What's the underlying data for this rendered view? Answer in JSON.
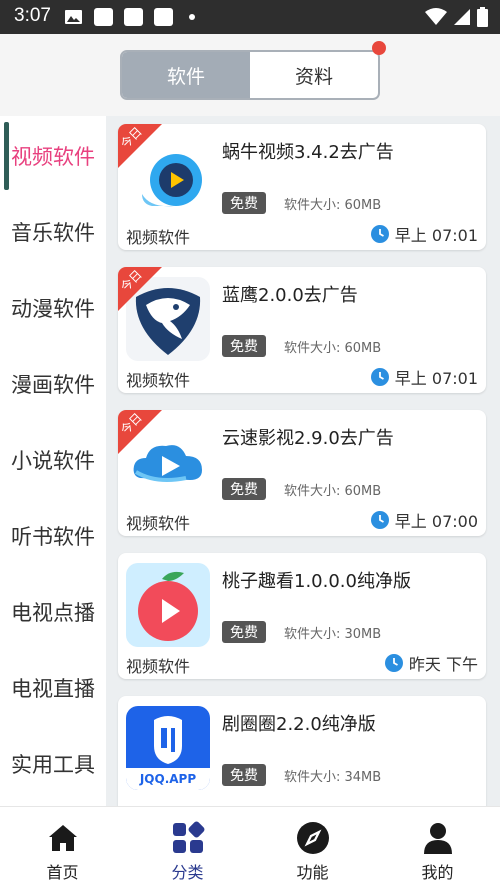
{
  "status_bar": {
    "time": "3:07"
  },
  "tabs": [
    {
      "label": "软件",
      "active": true
    },
    {
      "label": "资料",
      "active": false
    }
  ],
  "sidebar": {
    "items": [
      {
        "label": "视频软件",
        "active": true
      },
      {
        "label": "音乐软件"
      },
      {
        "label": "动漫软件"
      },
      {
        "label": "漫画软件"
      },
      {
        "label": "小说软件"
      },
      {
        "label": "听书软件"
      },
      {
        "label": "电视点播"
      },
      {
        "label": "电视直播"
      },
      {
        "label": "实用工具"
      }
    ]
  },
  "apps": [
    {
      "title": "蜗牛视频3.4.2去广告",
      "badge": "免费",
      "size": "软件大小: 60MB",
      "category": "视频软件",
      "time": "早上 07:01",
      "ribbon": "今日",
      "icon": "snail-video-icon"
    },
    {
      "title": "蓝鹰2.0.0去广告",
      "badge": "免费",
      "size": "软件大小: 60MB",
      "category": "视频软件",
      "time": "早上 07:01",
      "ribbon": "今日",
      "icon": "blue-eagle-icon"
    },
    {
      "title": "云速影视2.9.0去广告",
      "badge": "免费",
      "size": "软件大小: 60MB",
      "category": "视频软件",
      "time": "早上 07:00",
      "ribbon": "今日",
      "icon": "cloud-play-icon"
    },
    {
      "title": "桃子趣看1.0.0.0纯净版",
      "badge": "免费",
      "size": "软件大小: 30MB",
      "category": "视频软件",
      "time": "昨天 下午",
      "icon": "peach-play-icon"
    },
    {
      "title": "剧圈圈2.2.0纯净版",
      "badge": "免费",
      "size": "软件大小: 34MB",
      "icon_text": "JQQ.APP",
      "icon": "jqq-app-icon"
    }
  ],
  "bottom_nav": [
    {
      "label": "首页",
      "icon": "home-icon"
    },
    {
      "label": "分类",
      "icon": "category-icon",
      "active": true
    },
    {
      "label": "功能",
      "icon": "compass-icon"
    },
    {
      "label": "我的",
      "icon": "user-icon"
    }
  ],
  "colors": {
    "accent_pink": "#e8417f",
    "ribbon_red": "#e8473c",
    "nav_active": "#2a3a8f",
    "tab_active": "#a3acb6"
  }
}
